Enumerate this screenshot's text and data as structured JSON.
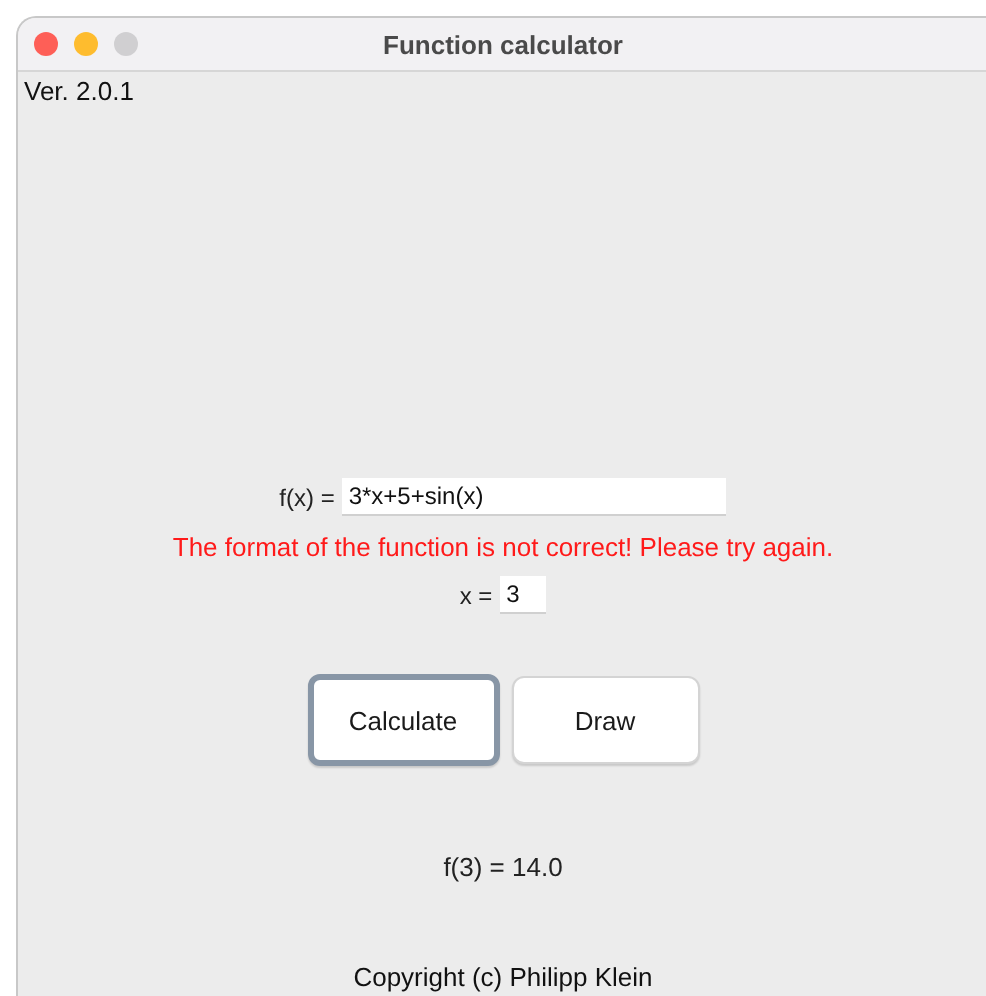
{
  "window": {
    "title": "Function calculator"
  },
  "version": "Ver. 2.0.1",
  "function_field": {
    "label": "f(x) =",
    "value": "3*x+5+sin(x)"
  },
  "error_message": "The format of the function is not correct! Please try again.",
  "x_field": {
    "label": "x =",
    "value": "3"
  },
  "buttons": [
    {
      "label": "Calculate",
      "focused": true
    },
    {
      "label": "Draw",
      "focused": false
    }
  ],
  "result": "f(3) = 14.0",
  "footer": "Copyright (c) Philipp Klein"
}
